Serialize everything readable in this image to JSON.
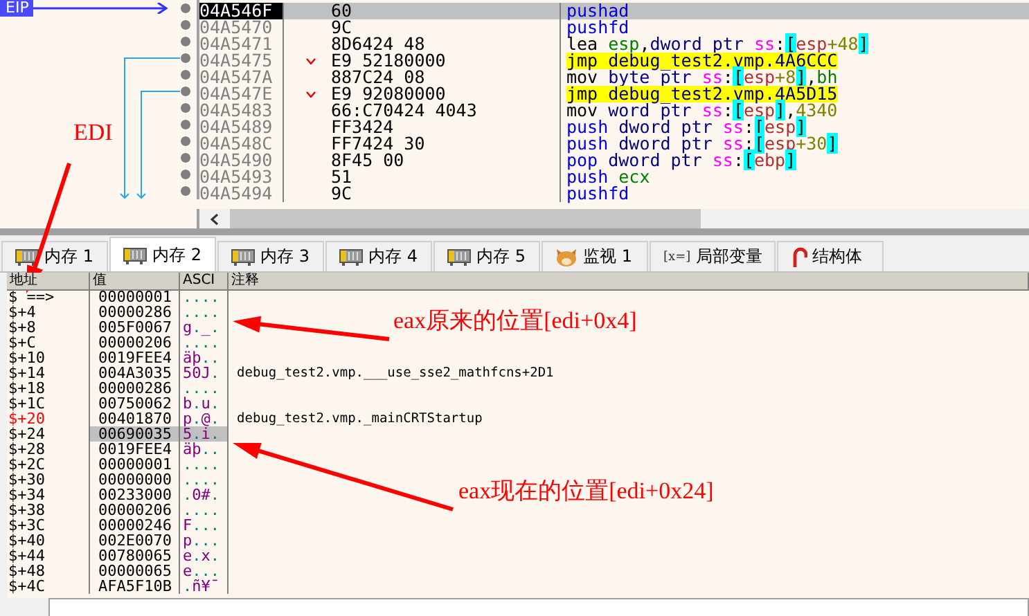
{
  "disassembly": {
    "eip_label": "EIP",
    "rows": [
      {
        "address": "04A546F",
        "bytes": "60",
        "jump": false,
        "selected": true,
        "highlight": false,
        "tokens": [
          {
            "text": "pushad",
            "kind": "stack"
          }
        ]
      },
      {
        "address": "04A5470",
        "bytes": "9C",
        "jump": false,
        "selected": false,
        "highlight": false,
        "tokens": [
          {
            "text": "pushfd",
            "kind": "stack"
          }
        ]
      },
      {
        "address": "04A5471",
        "bytes": "8D6424 48",
        "jump": false,
        "selected": false,
        "highlight": false,
        "tokens": [
          {
            "text": "lea ",
            "kind": "op"
          },
          {
            "text": "esp",
            "kind": "reg"
          },
          {
            "text": ",",
            "kind": "punct"
          },
          {
            "text": "dword ptr ",
            "kind": "size"
          },
          {
            "text": "ss",
            "kind": "seg"
          },
          {
            "text": ":",
            "kind": "punct"
          },
          {
            "text": "[",
            "kind": "bracket"
          },
          {
            "text": "esp",
            "kind": "memreg"
          },
          {
            "text": "+48",
            "kind": "num"
          },
          {
            "text": "]",
            "kind": "bracket"
          }
        ]
      },
      {
        "address": "04A5475",
        "bytes": "E9 52180000",
        "jump": true,
        "selected": false,
        "highlight": true,
        "tokens": [
          {
            "text": "jmp ",
            "kind": "op"
          },
          {
            "text": "debug_test2.vmp.4A6CCC",
            "kind": "sym"
          }
        ]
      },
      {
        "address": "04A547A",
        "bytes": "887C24 08",
        "jump": false,
        "selected": false,
        "highlight": false,
        "tokens": [
          {
            "text": "mov ",
            "kind": "op"
          },
          {
            "text": "byte ptr ",
            "kind": "size"
          },
          {
            "text": "ss",
            "kind": "seg"
          },
          {
            "text": ":",
            "kind": "punct"
          },
          {
            "text": "[",
            "kind": "bracket"
          },
          {
            "text": "esp",
            "kind": "memreg"
          },
          {
            "text": "+8",
            "kind": "num"
          },
          {
            "text": "]",
            "kind": "bracket"
          },
          {
            "text": ",",
            "kind": "punct"
          },
          {
            "text": "bh",
            "kind": "reg"
          }
        ]
      },
      {
        "address": "04A547E",
        "bytes": "E9 92080000",
        "jump": true,
        "selected": false,
        "highlight": true,
        "tokens": [
          {
            "text": "jmp ",
            "kind": "op"
          },
          {
            "text": "debug_test2.vmp.4A5D15",
            "kind": "sym"
          }
        ]
      },
      {
        "address": "04A5483",
        "bytes": "66:C70424 4043",
        "jump": false,
        "selected": false,
        "highlight": false,
        "tokens": [
          {
            "text": "mov ",
            "kind": "op"
          },
          {
            "text": "word ptr ",
            "kind": "size"
          },
          {
            "text": "ss",
            "kind": "seg"
          },
          {
            "text": ":",
            "kind": "punct"
          },
          {
            "text": "[",
            "kind": "bracket"
          },
          {
            "text": "esp",
            "kind": "memreg"
          },
          {
            "text": "]",
            "kind": "bracket"
          },
          {
            "text": ",",
            "kind": "punct"
          },
          {
            "text": "4340",
            "kind": "num"
          }
        ]
      },
      {
        "address": "04A5489",
        "bytes": "FF3424",
        "jump": false,
        "selected": false,
        "highlight": false,
        "tokens": [
          {
            "text": "push ",
            "kind": "stack"
          },
          {
            "text": "dword ptr ",
            "kind": "size"
          },
          {
            "text": "ss",
            "kind": "seg"
          },
          {
            "text": ":",
            "kind": "punct"
          },
          {
            "text": "[",
            "kind": "bracket"
          },
          {
            "text": "esp",
            "kind": "memreg"
          },
          {
            "text": "]",
            "kind": "bracket"
          }
        ]
      },
      {
        "address": "04A548C",
        "bytes": "FF7424 30",
        "jump": false,
        "selected": false,
        "highlight": false,
        "tokens": [
          {
            "text": "push ",
            "kind": "stack"
          },
          {
            "text": "dword ptr ",
            "kind": "size"
          },
          {
            "text": "ss",
            "kind": "seg"
          },
          {
            "text": ":",
            "kind": "punct"
          },
          {
            "text": "[",
            "kind": "bracket"
          },
          {
            "text": "esp",
            "kind": "memreg"
          },
          {
            "text": "+30",
            "kind": "num"
          },
          {
            "text": "]",
            "kind": "bracket"
          }
        ]
      },
      {
        "address": "04A5490",
        "bytes": "8F45 00",
        "jump": false,
        "selected": false,
        "highlight": false,
        "tokens": [
          {
            "text": "pop ",
            "kind": "stack"
          },
          {
            "text": "dword ptr ",
            "kind": "size"
          },
          {
            "text": "ss",
            "kind": "seg"
          },
          {
            "text": ":",
            "kind": "punct"
          },
          {
            "text": "[",
            "kind": "bracket"
          },
          {
            "text": "ebp",
            "kind": "memreg"
          },
          {
            "text": "]",
            "kind": "bracket"
          }
        ]
      },
      {
        "address": "04A5493",
        "bytes": "51",
        "jump": false,
        "selected": false,
        "highlight": false,
        "tokens": [
          {
            "text": "push ",
            "kind": "stack"
          },
          {
            "text": "ecx",
            "kind": "reg"
          }
        ]
      },
      {
        "address": "04A5494",
        "bytes": "9C",
        "jump": false,
        "selected": false,
        "highlight": false,
        "tokens": [
          {
            "text": "pushfd",
            "kind": "stack"
          }
        ]
      }
    ]
  },
  "tabs": [
    {
      "label": "内存 1",
      "kind": "memory",
      "selected": false
    },
    {
      "label": "内存 2",
      "kind": "memory",
      "selected": true
    },
    {
      "label": "内存 3",
      "kind": "memory",
      "selected": false
    },
    {
      "label": "内存 4",
      "kind": "memory",
      "selected": false
    },
    {
      "label": "内存 5",
      "kind": "memory",
      "selected": false
    },
    {
      "label": "监视 1",
      "kind": "watch",
      "selected": false
    },
    {
      "label": "局部变量",
      "kind": "locals",
      "icon_text": "[x=]",
      "selected": false
    },
    {
      "label": "结构体",
      "kind": "struct",
      "selected": false
    }
  ],
  "stack_view": {
    "columns": [
      "地址",
      "值",
      "ASCI",
      "注释"
    ],
    "rows": [
      {
        "address": "$ ==>",
        "value": "00000001",
        "ascii": "....",
        "marked": false,
        "selected": false
      },
      {
        "address": "$+4",
        "value": "00000286",
        "ascii": "....",
        "marked": false,
        "selected": false
      },
      {
        "address": "$+8",
        "value": "005F0067",
        "ascii": "g._.",
        "marked": false,
        "selected": false
      },
      {
        "address": "$+C",
        "value": "00000206",
        "ascii": "....",
        "marked": false,
        "selected": false
      },
      {
        "address": "$+10",
        "value": "0019FEE4",
        "ascii": "äþ..",
        "marked": false,
        "selected": false
      },
      {
        "address": "$+14",
        "value": "004A3035",
        "ascii": "50J.",
        "comment": "debug_test2.vmp.___use_sse2_mathfcns+2D1",
        "marked": false,
        "selected": false
      },
      {
        "address": "$+18",
        "value": "00000286",
        "ascii": "....",
        "marked": false,
        "selected": false
      },
      {
        "address": "$+1C",
        "value": "00750062",
        "ascii": "b.u.",
        "marked": false,
        "selected": false
      },
      {
        "address": "$+20",
        "value": "00401870",
        "ascii": "p.@.",
        "comment": "debug_test2.vmp._mainCRTStartup",
        "marked": true,
        "selected": false
      },
      {
        "address": "$+24",
        "value": "00690035",
        "ascii": "5.i.",
        "marked": false,
        "selected": true
      },
      {
        "address": "$+28",
        "value": "0019FEE4",
        "ascii": "äþ..",
        "marked": false,
        "selected": false
      },
      {
        "address": "$+2C",
        "value": "00000001",
        "ascii": "....",
        "marked": false,
        "selected": false
      },
      {
        "address": "$+30",
        "value": "00000000",
        "ascii": "....",
        "marked": false,
        "selected": false
      },
      {
        "address": "$+34",
        "value": "00233000",
        "ascii": ".0#.",
        "marked": false,
        "selected": false
      },
      {
        "address": "$+38",
        "value": "00000206",
        "ascii": "....",
        "marked": false,
        "selected": false
      },
      {
        "address": "$+3C",
        "value": "00000246",
        "ascii": "F...",
        "marked": false,
        "selected": false
      },
      {
        "address": "$+40",
        "value": "002E0070",
        "ascii": "p...",
        "marked": false,
        "selected": false
      },
      {
        "address": "$+44",
        "value": "00780065",
        "ascii": "e.x.",
        "marked": false,
        "selected": false
      },
      {
        "address": "$+48",
        "value": "00000065",
        "ascii": "e...",
        "marked": false,
        "selected": false
      },
      {
        "address": "$+4C",
        "value": "AFA5F10B",
        "ascii": ".ñ¥¯",
        "marked": false,
        "selected": false
      }
    ]
  },
  "annotations": [
    {
      "text": "EDI"
    },
    {
      "text": "eax原来的位置[edi+0x4]"
    },
    {
      "text": "eax现在的位置[edi+0x24]"
    }
  ]
}
